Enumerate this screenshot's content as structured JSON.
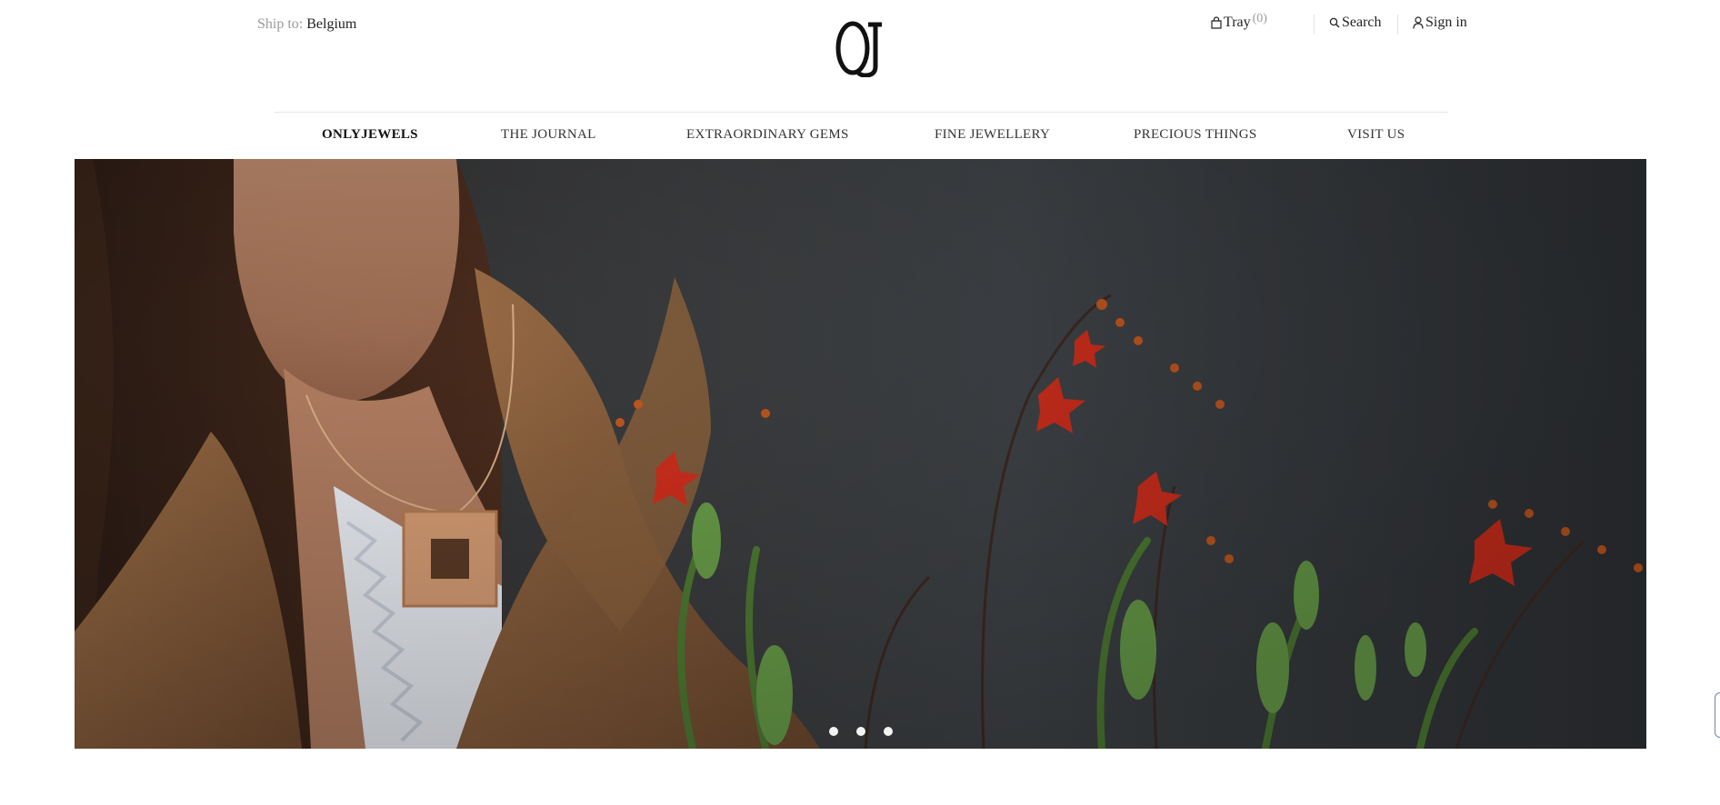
{
  "header": {
    "ship_to_label": "Ship to:",
    "ship_to_country": "Belgium",
    "logo_text": "OJ",
    "tray_label": "Tray",
    "tray_count": "(0)",
    "search_label": "Search",
    "sign_in_label": "Sign in"
  },
  "nav": {
    "items": [
      {
        "label": "ONLYJEWELS"
      },
      {
        "label": "THE JOURNAL"
      },
      {
        "label": "EXTRAORDINARY GEMS"
      },
      {
        "label": "FINE JEWELLERY"
      },
      {
        "label": "PRECIOUS THINGS"
      },
      {
        "label": "VISIT US"
      }
    ],
    "active_index": 0
  },
  "hero": {
    "slide_count": 3,
    "active_slide": 1
  },
  "colors": {
    "background": "#ffffff",
    "hero_dark": "#3a3d41",
    "coat": "#8a6240",
    "flower_red": "#d8321f",
    "stem_green": "#4e8a3a",
    "pendant_gold": "#d6a37a"
  }
}
